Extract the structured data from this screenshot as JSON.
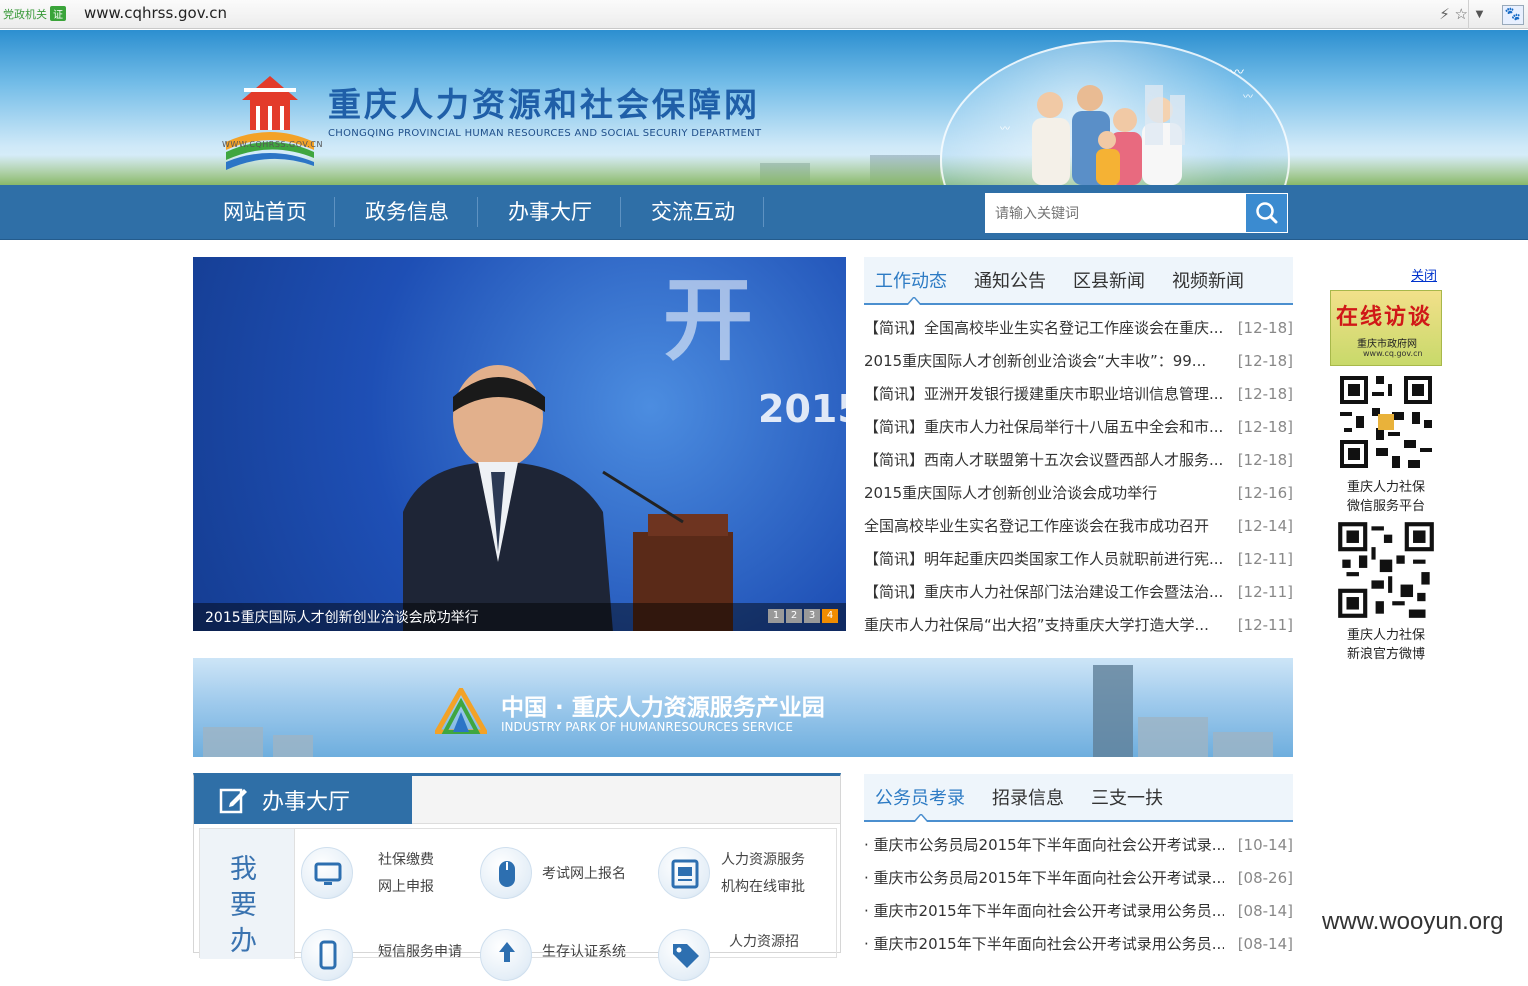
{
  "browser": {
    "cert_label": "党政机关",
    "cert_badge": "证",
    "url": "www.cqhrss.gov.cn"
  },
  "header": {
    "logo_url_text": "WWW.CQHRSS.GOV.CN",
    "title": "重庆人力资源和社会保障网",
    "subtitle": "CHONGQING PROVINCIAL HUMAN RESOURCES AND SOCIAL SECURIY DEPARTMENT"
  },
  "nav": {
    "items": [
      "网站首页",
      "政务信息",
      "办事大厅",
      "交流互动"
    ],
    "search_placeholder": "请输入关键词"
  },
  "slider": {
    "caption": "2015重庆国际人才创新创业洽谈会成功举行",
    "pages": [
      "1",
      "2",
      "3",
      "4"
    ],
    "active_page": "4",
    "backdrop_text_1": "开",
    "backdrop_text_2": "2015"
  },
  "news_tabs": {
    "tabs": [
      "工作动态",
      "通知公告",
      "区县新闻",
      "视频新闻"
    ],
    "active": "工作动态",
    "items": [
      {
        "title": "【简讯】全国高校毕业生实名登记工作座谈会在重庆...",
        "date": "[12-18]"
      },
      {
        "title": "2015重庆国际人才创新创业洽谈会“大丰收”：99...",
        "date": "[12-18]"
      },
      {
        "title": "【简讯】亚洲开发银行援建重庆市职业培训信息管理...",
        "date": "[12-18]"
      },
      {
        "title": "【简讯】重庆市人力社保局举行十八届五中全会和市...",
        "date": "[12-18]"
      },
      {
        "title": "【简讯】西南人才联盟第十五次会议暨西部人才服务...",
        "date": "[12-18]"
      },
      {
        "title": "2015重庆国际人才创新创业洽谈会成功举行",
        "date": "[12-16]"
      },
      {
        "title": "全国高校毕业生实名登记工作座谈会在我市成功召开",
        "date": "[12-14]"
      },
      {
        "title": "【简讯】明年起重庆四类国家工作人员就职前进行宪...",
        "date": "[12-11]"
      },
      {
        "title": "【简讯】重庆市人力社保部门法治建设工作会暨法治...",
        "date": "[12-11]"
      },
      {
        "title": "重庆市人力社保局“出大招”支持重庆大学打造大学...",
        "date": "[12-11]"
      }
    ]
  },
  "sidebar": {
    "close_label": "关闭",
    "interview_big": "在线访谈",
    "interview_small": "重庆市政府网",
    "interview_url": "www.cq.gov.cn",
    "qr1_label": [
      "重庆人力社保",
      "微信服务平台"
    ],
    "qr2_label": [
      "重庆人力社保",
      "新浪官方微博"
    ]
  },
  "banner": {
    "title": "中国 · 重庆人力资源服务产业园",
    "subtitle": "INDUSTRY PARK OF HUMANRESOURCES SERVICE"
  },
  "hall": {
    "title": "办事大厅",
    "wo_chars": [
      "我",
      "要",
      "办"
    ],
    "services": [
      {
        "line1": "社保缴费",
        "line2": "网上申报",
        "icon": "monitor-icon"
      },
      {
        "line1": "考试网上报名",
        "line2": "",
        "icon": "mouse-icon"
      },
      {
        "line1": "人力资源服务",
        "line2": "机构在线审批",
        "icon": "document-icon"
      },
      {
        "line1": "短信服务申请",
        "line2": "",
        "icon": "phone-icon"
      },
      {
        "line1": "生存认证系统",
        "line2": "",
        "icon": "upload-icon"
      },
      {
        "line1": "人力资源招",
        "line2": "",
        "icon": "tag-icon"
      }
    ]
  },
  "exam_tabs": {
    "tabs": [
      "公务员考录",
      "招录信息",
      "三支一扶"
    ],
    "active": "公务员考录",
    "items": [
      {
        "title": "· 重庆市公务员局2015年下半年面向社会公开考试录...",
        "date": "[10-14]"
      },
      {
        "title": "· 重庆市公务员局2015年下半年面向社会公开考试录...",
        "date": "[08-26]"
      },
      {
        "title": "· 重庆市2015年下半年面向社会公开考试录用公务员...",
        "date": "[08-14]"
      },
      {
        "title": "· 重庆市2015年下半年面向社会公开考试录用公务员...",
        "date": "[08-14]"
      }
    ]
  },
  "watermark": "www.wooyun.org",
  "colors": {
    "nav_blue": "#2f6fa7",
    "accent_blue": "#2d7bc4",
    "active_dot": "#f08c00"
  }
}
